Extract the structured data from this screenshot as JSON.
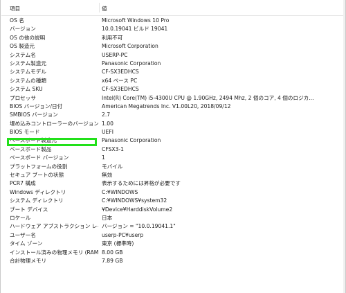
{
  "table": {
    "header": {
      "item": "項目",
      "value": "値"
    },
    "rows": [
      {
        "item": "OS 名",
        "value": "Microsoft Windows 10 Pro"
      },
      {
        "item": "バージョン",
        "value": "10.0.19041 ビルド 19041"
      },
      {
        "item": "OS の他の説明",
        "value": "利用不可"
      },
      {
        "item": "OS 製造元",
        "value": "Microsoft Corporation"
      },
      {
        "item": "システム名",
        "value": "USERP-PC"
      },
      {
        "item": "システム製造元",
        "value": "Panasonic Corporation"
      },
      {
        "item": "システムモデル",
        "value": "CF-SX3EDHCS"
      },
      {
        "item": "システムの種類",
        "value": "x64 ベース PC"
      },
      {
        "item": "システム SKU",
        "value": "CF-SX3EDHCS"
      },
      {
        "item": "プロセッサ",
        "value": "Intel(R) Core(TM) i5-4300U CPU @ 1.90GHz, 2494 Mhz, 2 個のコア, 4 個のロジカ..."
      },
      {
        "item": "BIOS バージョン/日付",
        "value": "American Megatrends Inc. V1.00L20, 2018/09/12"
      },
      {
        "item": "SMBIOS バージョン",
        "value": "2.7"
      },
      {
        "item": "埋め込みコントローラーのバージョン",
        "value": "1.00"
      },
      {
        "item": "BIOS モード",
        "value": "UEFI"
      },
      {
        "item": "ベースボード製造元",
        "value": "Panasonic Corporation"
      },
      {
        "item": "ベースボード製品",
        "value": "CFSX3-1"
      },
      {
        "item": "ベースボード バージョン",
        "value": "1"
      },
      {
        "item": "プラットフォームの役割",
        "value": "モバイル"
      },
      {
        "item": "セキュア ブートの状態",
        "value": "無効"
      },
      {
        "item": "PCR7 構成",
        "value": "表示するためには昇格が必要です"
      },
      {
        "item": "Windows ディレクトリ",
        "value": "C:¥WINDOWS"
      },
      {
        "item": "システム ディレクトリ",
        "value": "C:¥WINDOWS¥system32"
      },
      {
        "item": "ブート デバイス",
        "value": "¥Device¥HarddiskVolume2"
      },
      {
        "item": "ロケール",
        "value": "日本"
      },
      {
        "item": "ハードウェア アブストラクション レイヤー",
        "value": "バージョン = \"10.0.19041.1\""
      },
      {
        "item": "ユーザー名",
        "value": "userp-PC¥userp"
      },
      {
        "item": "タイム ゾーン",
        "value": "東京 (標準時)"
      },
      {
        "item": "インストール済みの物理メモリ (RAM)",
        "value": "8.00 GB"
      },
      {
        "item": "合計物理メモリ",
        "value": "7.89 GB"
      }
    ]
  },
  "highlight_color": "#22e01a"
}
